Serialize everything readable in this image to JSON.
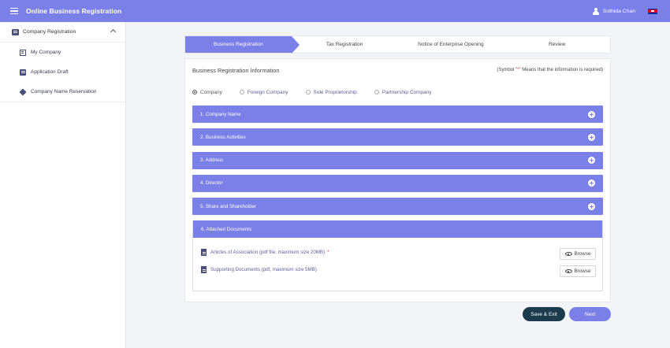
{
  "header": {
    "title": "Online Business Registration",
    "username": "Sothida Chan",
    "menu_icon": "hamburger-menu-icon",
    "user_icon": "user-icon",
    "flag_icon": "cambodia-flag-icon"
  },
  "sidebar": {
    "section": {
      "label": "Company Registration",
      "icon": "building-icon",
      "expanded": true
    },
    "items": [
      {
        "label": "My Company",
        "icon": "company-card-icon"
      },
      {
        "label": "Application Draft",
        "icon": "draft-icon"
      },
      {
        "label": "Company Name Reservation",
        "icon": "reservation-icon"
      }
    ]
  },
  "steps": [
    {
      "label": "Business Registration",
      "active": true
    },
    {
      "label": "Tax Registration",
      "active": false
    },
    {
      "label": "Notice of Enterprise Opening",
      "active": false
    },
    {
      "label": "Review",
      "active": false
    }
  ],
  "form": {
    "title": "Business Registration Information",
    "note_prefix": "(Symbol \"",
    "note_star": "*",
    "note_suffix": "\" Means that the information is required)",
    "company_types": [
      {
        "label": "Company",
        "selected": true
      },
      {
        "label": "Foreign Company",
        "selected": false
      },
      {
        "label": "Sole Proprietorship",
        "selected": false
      },
      {
        "label": "Partnership Company",
        "selected": false
      }
    ],
    "sections": [
      {
        "label": "1. Company Name"
      },
      {
        "label": "2. Business Activities"
      },
      {
        "label": "3. Address"
      },
      {
        "label": "4. Director"
      },
      {
        "label": "5. Share and Shareholder"
      }
    ],
    "attachments": {
      "label": "6. Attached Documents",
      "documents": [
        {
          "label": "Articles of Association (pdf file, maximum size 20MB)",
          "required_mark": "*",
          "browse_label": "Browse"
        },
        {
          "label": "Supporting Documents (pdf, maximum size 5MB)",
          "required_mark": "",
          "browse_label": "Browse"
        }
      ]
    }
  },
  "actions": {
    "save_exit": "Save & Exit",
    "next": "Next"
  },
  "colors": {
    "primary": "#7b7fe8",
    "dark_button": "#1c3c4d",
    "required": "#e53b3b"
  }
}
